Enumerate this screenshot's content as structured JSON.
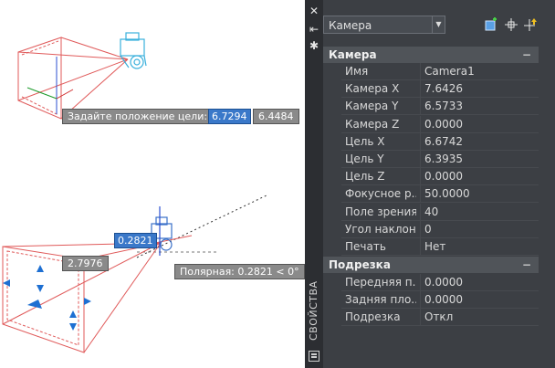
{
  "viewport": {
    "tooltip_top": {
      "label": "Задайте положение цели:",
      "value_selected": "6.7294",
      "value_second": "6.4484"
    },
    "tooltip_bottom": {
      "value_selected": "0.2821",
      "value_length": "2.7976",
      "polar_label": "Полярная: 0.2821 < 0°"
    }
  },
  "palette": {
    "title": "СВОЙСТВА",
    "object_selector": "Камера",
    "sections": {
      "camera": {
        "header": "Камера",
        "rows": [
          {
            "label": "Имя",
            "value": "Camera1"
          },
          {
            "label": "Камера X",
            "value": "7.6426"
          },
          {
            "label": "Камера Y",
            "value": "6.5733"
          },
          {
            "label": "Камера Z",
            "value": "0.0000"
          },
          {
            "label": "Цель X",
            "value": "6.6742"
          },
          {
            "label": "Цель Y",
            "value": "6.3935"
          },
          {
            "label": "Цель Z",
            "value": "0.0000"
          },
          {
            "label": "Фокусное р...",
            "value": "50.0000"
          },
          {
            "label": "Поле зрения",
            "value": "40"
          },
          {
            "label": "Угол наклона",
            "value": "0"
          },
          {
            "label": "Печать",
            "value": "Нет"
          }
        ]
      },
      "clipping": {
        "header": "Подрезка",
        "rows": [
          {
            "label": "Передняя п...",
            "value": "0.0000"
          },
          {
            "label": "Задняя пло...",
            "value": "0.0000"
          },
          {
            "label": "Подрезка",
            "value": "Откл"
          }
        ]
      }
    },
    "collapse_glyph": "−",
    "strip_glyphs": {
      "close": "✕",
      "autohide": "⇤",
      "settings": "✱"
    }
  }
}
